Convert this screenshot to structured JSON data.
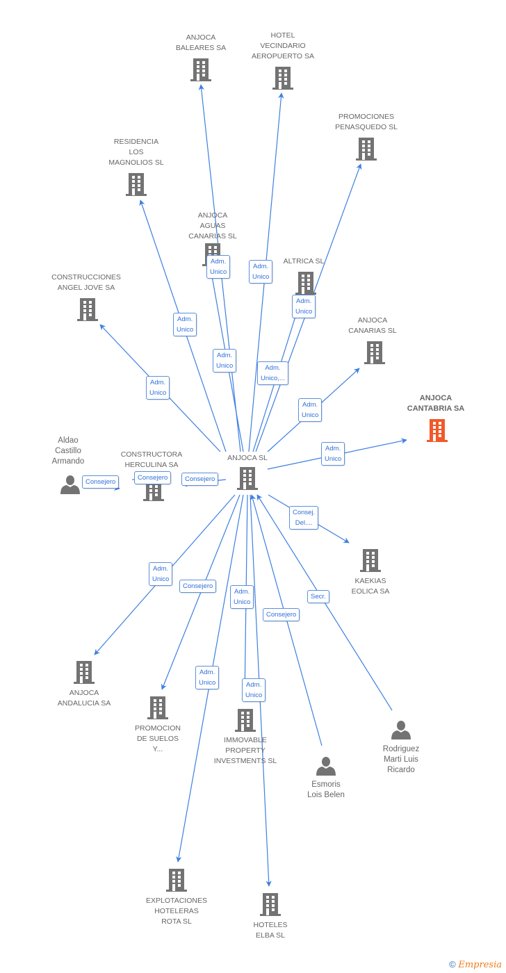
{
  "colors": {
    "edge": "#3d7fe0",
    "node": "#737373",
    "highlight": "#f05a2a"
  },
  "nodes": [
    {
      "id": "center",
      "lines": [
        "ANJOCA SL"
      ],
      "type": "company",
      "main": false
    },
    {
      "id": "baleares",
      "lines": [
        "ANJOCA",
        "BALEARES SA"
      ],
      "type": "company"
    },
    {
      "id": "vecindario",
      "lines": [
        "HOTEL",
        "VECINDARIO",
        "AEROPUERTO SA"
      ],
      "type": "company"
    },
    {
      "id": "penasquedo",
      "lines": [
        "PROMOCIONES",
        "PENASQUEDO SL"
      ],
      "type": "company"
    },
    {
      "id": "magnolios",
      "lines": [
        "RESIDENCIA",
        "LOS",
        "MAGNOLIOS SL"
      ],
      "type": "company"
    },
    {
      "id": "aguas",
      "lines": [
        "ANJOCA",
        "AGUAS",
        "CANARIAS SL"
      ],
      "type": "company"
    },
    {
      "id": "altrica",
      "lines": [
        "ALTRICA SL"
      ],
      "type": "company"
    },
    {
      "id": "angeljove",
      "lines": [
        "CONSTRUCCIONES",
        "ANGEL JOVE SA"
      ],
      "type": "company"
    },
    {
      "id": "canarias",
      "lines": [
        "ANJOCA",
        "CANARIAS SL"
      ],
      "type": "company"
    },
    {
      "id": "cantabria",
      "lines": [
        "ANJOCA",
        "CANTABRIA SA"
      ],
      "type": "company",
      "main": true
    },
    {
      "id": "herculina",
      "lines": [
        "CONSTRUCTORA",
        "HERCULINA SA"
      ],
      "type": "company"
    },
    {
      "id": "aldao",
      "lines": [
        "Aldao",
        "Castillo",
        "Armando"
      ],
      "type": "person"
    },
    {
      "id": "kaekias",
      "lines": [
        "KAEKIAS",
        "EOLICA SA"
      ],
      "type": "company"
    },
    {
      "id": "andalucia",
      "lines": [
        "ANJOCA",
        "ANDALUCIA SA"
      ],
      "type": "company"
    },
    {
      "id": "suelos",
      "lines": [
        "PROMOCION",
        "DE SUELOS",
        "Y..."
      ],
      "type": "company"
    },
    {
      "id": "immovable",
      "lines": [
        "IMMOVABLE",
        "PROPERTY",
        "INVESTMENTS SL"
      ],
      "type": "company"
    },
    {
      "id": "esmoris",
      "lines": [
        "Esmoris",
        "Lois Belen"
      ],
      "type": "person"
    },
    {
      "id": "rodriguez",
      "lines": [
        "Rodriguez",
        "Marti Luis",
        "Ricardo"
      ],
      "type": "person"
    },
    {
      "id": "rota",
      "lines": [
        "EXPLOTACIONES",
        "HOTELERAS",
        "ROTA SL"
      ],
      "type": "company"
    },
    {
      "id": "elba",
      "lines": [
        "HOTELES",
        "ELBA SL"
      ],
      "type": "company"
    }
  ],
  "edges": [
    {
      "from": "center",
      "to": "aguas",
      "label": "Adm.\nUnico"
    },
    {
      "from": "center",
      "to": "vecindario",
      "label": "Adm.\nUnico"
    },
    {
      "from": "center",
      "to": "penasquedo",
      "label": "Adm.\nUnico"
    },
    {
      "from": "center",
      "to": "magnolios",
      "label": "Adm.\nUnico"
    },
    {
      "from": "center",
      "to": "baleares",
      "label": "Adm.\nUnico"
    },
    {
      "from": "center",
      "to": "altrica",
      "label": "Adm.\nUnico,..."
    },
    {
      "from": "center",
      "to": "angeljove",
      "label": "Adm.\nUnico"
    },
    {
      "from": "center",
      "to": "canarias",
      "label": "Adm.\nUnico"
    },
    {
      "from": "center",
      "to": "cantabria",
      "label": "Adm.\nUnico"
    },
    {
      "from": "aldao",
      "to": "herculina",
      "label": "Consejero"
    },
    {
      "from": "aldao",
      "to": "herculina",
      "label": "Consejero"
    },
    {
      "from": "center",
      "to": "herculina",
      "label": "Consejero"
    },
    {
      "from": "center",
      "to": "kaekias",
      "label": "Consej.\nDel...."
    },
    {
      "from": "center",
      "to": "andalucia",
      "label": "Adm.\nUnico"
    },
    {
      "from": "center",
      "to": "suelos",
      "label": "Consejero"
    },
    {
      "from": "center",
      "to": "immovable",
      "label": "Adm.\nUnico"
    },
    {
      "from": "esmoris",
      "to": "center",
      "label": "Consejero"
    },
    {
      "from": "rodriguez",
      "to": "center",
      "label": "Secr."
    },
    {
      "from": "center",
      "to": "rota",
      "label": "Adm.\nUnico"
    },
    {
      "from": "center",
      "to": "elba",
      "label": "Adm.\nUnico"
    }
  ],
  "footer": {
    "copyright": "©",
    "brand": "Empresia"
  }
}
